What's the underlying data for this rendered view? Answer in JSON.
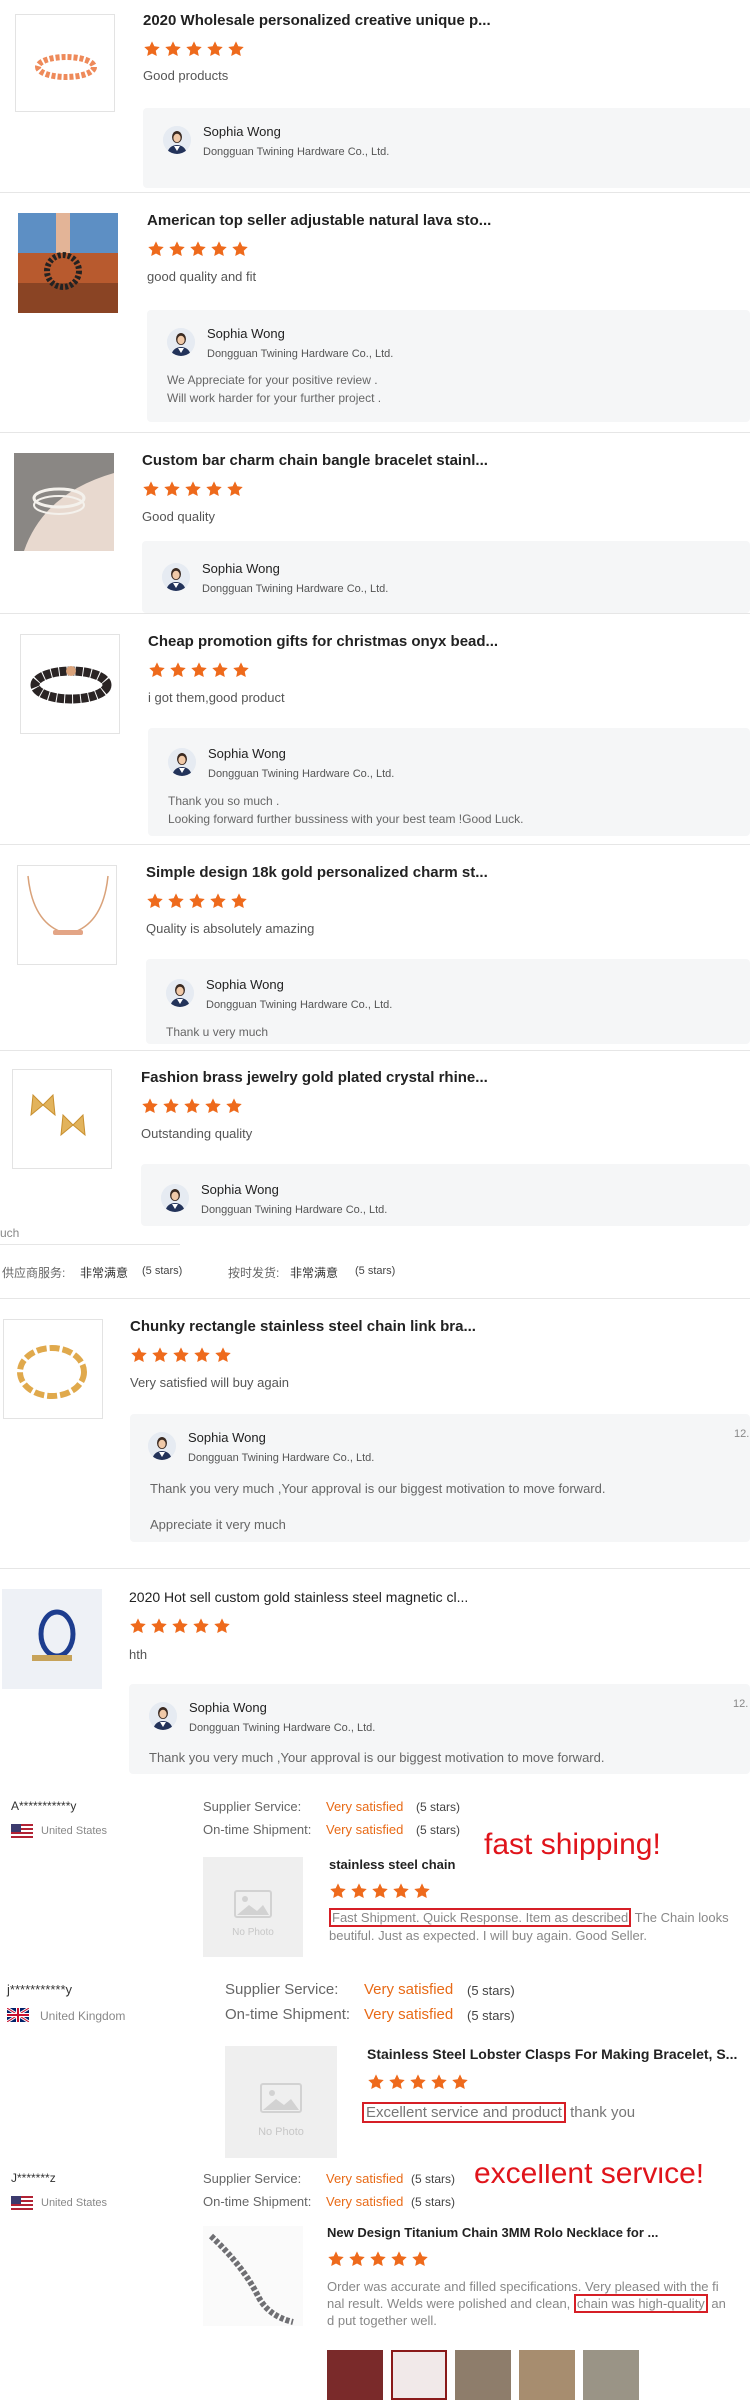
{
  "supplier": {
    "name": "Sophia Wong",
    "company": "Dongguan Twining Hardware Co., Ltd."
  },
  "reviews": [
    {
      "title": "2020 Wholesale personalized creative unique p...",
      "rating": 5,
      "text": "Good products",
      "reply": []
    },
    {
      "title": "American top seller adjustable natural lava sto...",
      "rating": 5,
      "text": "good quality and fit",
      "reply": [
        "We Appreciate for your positive review .",
        "Will work harder for your further project ."
      ]
    },
    {
      "title": "Custom bar charm chain bangle bracelet stainl...",
      "rating": 5,
      "text": "Good quality",
      "reply": []
    },
    {
      "title": "Cheap promotion gifts for christmas onyx bead...",
      "rating": 5,
      "text": "i got them,good product",
      "reply": [
        "Thank you so much .",
        "Looking forward further bussiness with your best team !Good Luck."
      ]
    },
    {
      "title": "Simple design 18k gold personalized charm st...",
      "rating": 5,
      "text": "Quality is absolutely amazing",
      "reply": [
        "Thank u very much"
      ]
    },
    {
      "title": "Fashion brass jewelry gold plated crystal rhine...",
      "rating": 5,
      "text": "Outstanding quality",
      "reply": []
    }
  ],
  "cn_strip": {
    "fragment": "uch",
    "service_label": "供应商服务:",
    "service_value": "非常满意",
    "service_count": "(5 stars)",
    "shipment_label": "按时发货:",
    "shipment_value": "非常满意",
    "shipment_count": "(5 stars)"
  },
  "reviews2": [
    {
      "title": "Chunky rectangle stainless steel chain link bra...",
      "rating": 5,
      "text": "Very satisfied will buy again",
      "date": "12.",
      "reply": [
        "Thank you very much ,Your approval is our biggest motivation to move forward.",
        "Appreciate it very much"
      ]
    },
    {
      "title": "2020 Hot sell custom gold stainless steel magnetic cl...",
      "rating": 5,
      "text": "hth",
      "date": "12.",
      "reply": [
        "Thank you very much ,Your approval is our biggest motivation to move forward."
      ]
    }
  ],
  "buyer_reviews": [
    {
      "user": "A***********y",
      "country": "United States",
      "supplier_service_label": "Supplier Service:",
      "supplier_service": "Very satisfied",
      "supplier_service_count": "(5 stars)",
      "shipment_label": "On-time Shipment:",
      "shipment": "Very satisfied",
      "shipment_count": "(5 stars)",
      "product": "stainless steel chain",
      "rating": 5,
      "no_photo": "No Photo",
      "text_highlight": "Fast Shipment. Quick Response. Item as described",
      "text_rest_1": " The Chain looks",
      "text_line2": "beutiful. Just as expected. I will buy again. Good Seller.",
      "annotation": "fast shipping!"
    },
    {
      "user": "j***********y",
      "country": "United Kingdom",
      "supplier_service_label": "Supplier Service:",
      "supplier_service": "Very satisfied",
      "supplier_service_count": "(5 stars)",
      "shipment_label": "On-time Shipment:",
      "shipment": "Very satisfied",
      "shipment_count": "(5 stars)",
      "product": "Stainless Steel Lobster Clasps For Making Bracelet, S...",
      "rating": 5,
      "no_photo": "No Photo",
      "text_highlight": "Excellent service and product",
      "text_rest_1": " thank you"
    },
    {
      "user": "J*******z",
      "country": "United States",
      "supplier_service_label": "Supplier Service:",
      "supplier_service": "Very satisfied",
      "supplier_service_count": "(5 stars)",
      "shipment_label": "On-time Shipment:",
      "shipment": "Very satisfied",
      "shipment_count": "(5 stars)",
      "product": "New Design Titanium Chain 3MM Rolo Necklace for ...",
      "rating": 5,
      "text_line1": "Order was accurate and filled specifications.  Very pleased with the fi",
      "text_line2_a": "nal result.  Welds were polished and clean, ",
      "text_line2_highlight": "chain was high-quality",
      "text_line2_b": " an",
      "text_line3": "d put together well.",
      "annotation": "excellent service!"
    }
  ],
  "colors": {
    "star": "#ee6a1c",
    "accent": "#e86a16",
    "annotation": "#e0141b",
    "reply_bg": "#f5f6f7"
  },
  "icons": [
    "star-icon",
    "avatar-icon",
    "flag-us-icon",
    "flag-uk-icon",
    "image-placeholder-icon"
  ]
}
